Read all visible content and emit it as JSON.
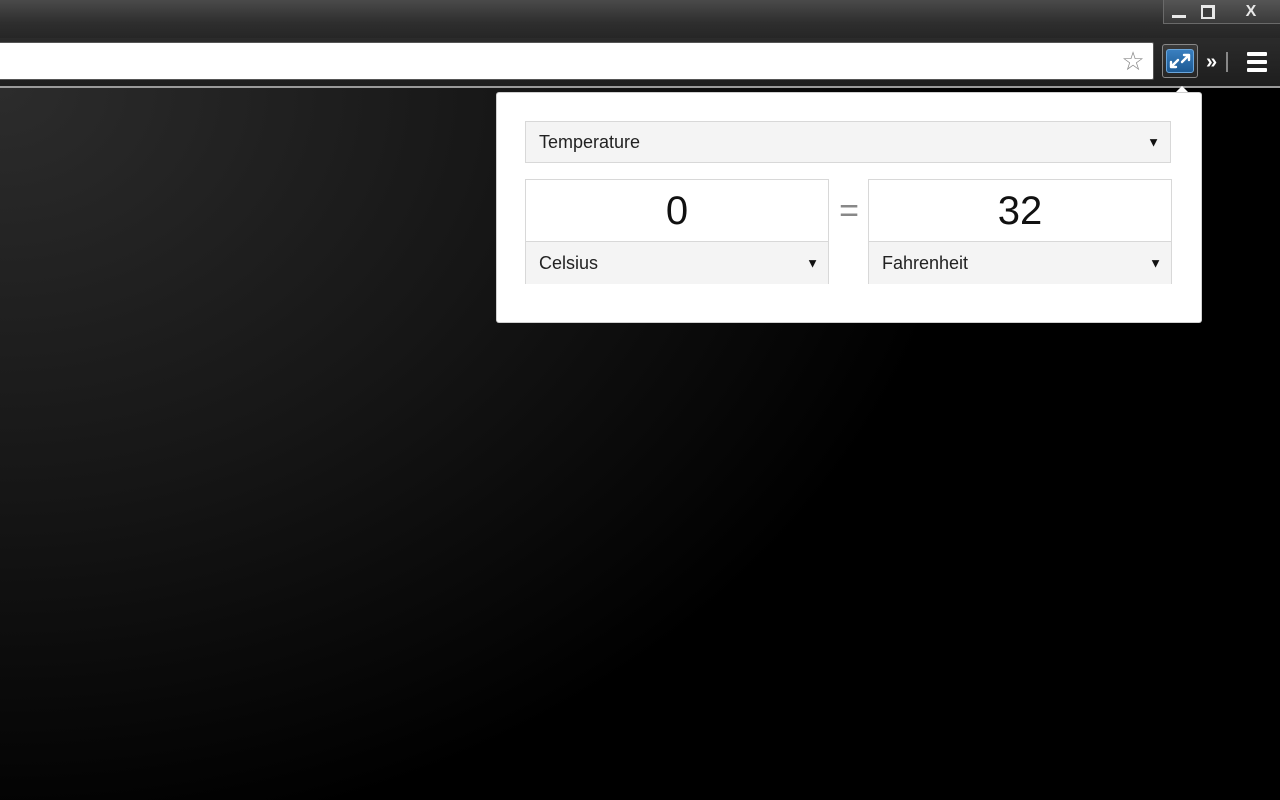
{
  "window": {
    "controls": {
      "minimize_label": "",
      "maximize_label": "",
      "close_label": "X"
    }
  },
  "toolbar": {
    "star_icon": "star-outline-icon",
    "extension_icon": "unit-converter-icon",
    "chevron_label": "»",
    "menu_icon": "hamburger-menu-icon"
  },
  "converter": {
    "category": "Temperature",
    "from": {
      "value": "0",
      "unit": "Celsius"
    },
    "equals": "=",
    "to": {
      "value": "32",
      "unit": "Fahrenheit"
    },
    "caret": "▼"
  },
  "colors": {
    "extension_accent": "#1d5a94",
    "popup_background": "#ffffff",
    "select_background": "#f4f4f4"
  }
}
